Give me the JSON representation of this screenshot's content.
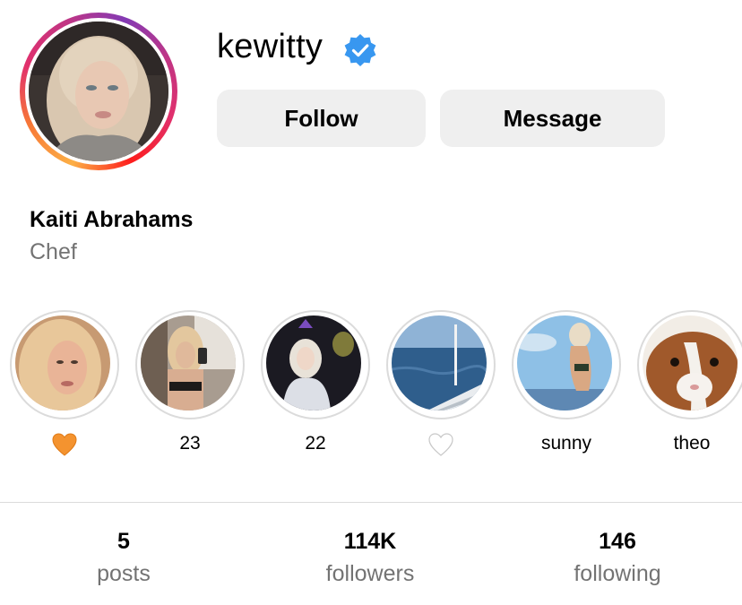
{
  "profile": {
    "username": "kewitty",
    "verified": true,
    "full_name": "Kaiti Abrahams",
    "bio": "Chef",
    "avatar_icon": "profile-photo"
  },
  "actions": {
    "follow_label": "Follow",
    "message_label": "Message"
  },
  "highlights": [
    {
      "label": "",
      "emoji": "orange-heart",
      "emoji_color": "#f4932f",
      "thumb": "selfie"
    },
    {
      "label": "23",
      "thumb": "mirror-selfie"
    },
    {
      "label": "22",
      "thumb": "party-balloon"
    },
    {
      "label": "",
      "emoji": "white-heart",
      "emoji_color": "#ffffff",
      "thumb": "sea-boat"
    },
    {
      "label": "sunny",
      "thumb": "beach"
    },
    {
      "label": "theo",
      "thumb": "guinea-pig"
    }
  ],
  "stats": {
    "posts": {
      "count": "5",
      "label": "posts"
    },
    "followers": {
      "count": "114K",
      "label": "followers"
    },
    "following": {
      "count": "146",
      "label": "following"
    }
  },
  "colors": {
    "verified_badge": "#3897f0",
    "button_bg": "#efefef",
    "secondary_text": "#737373",
    "divider": "#dbdbdb"
  }
}
